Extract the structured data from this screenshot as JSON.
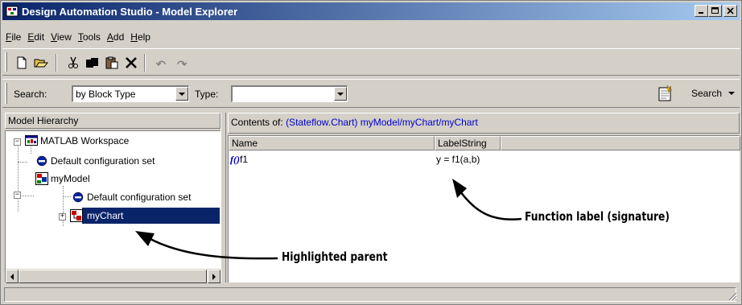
{
  "window": {
    "title": "Design Automation Studio - Model Explorer",
    "controls": {
      "minimize": "_",
      "maximize": "□",
      "close": "×"
    }
  },
  "menu": [
    {
      "label": "File",
      "accel": "F",
      "rest": "ile"
    },
    {
      "label": "Edit",
      "accel": "E",
      "rest": "dit"
    },
    {
      "label": "View",
      "accel": "V",
      "rest": "iew"
    },
    {
      "label": "Tools",
      "accel": "T",
      "rest": "ools"
    },
    {
      "label": "Add",
      "accel": "A",
      "rest": "dd"
    },
    {
      "label": "Help",
      "accel": "H",
      "rest": "elp"
    }
  ],
  "toolbar": {
    "buttons": [
      "new-icon",
      "open-icon",
      "cut-icon",
      "copy-icon",
      "paste-icon",
      "delete-icon",
      "undo-icon",
      "redo-icon"
    ]
  },
  "search": {
    "label": "Search:",
    "by_value": "by Block Type",
    "type_label": "Type:",
    "type_value": "",
    "button_label": "Search"
  },
  "hierarchy": {
    "header": "Model Hierarchy",
    "nodes": [
      {
        "label": "MATLAB Workspace",
        "icon": "workspace-icon"
      },
      {
        "label": "Default configuration set",
        "icon": "config-icon"
      },
      {
        "label": "myModel",
        "icon": "model-icon"
      },
      {
        "label": "Default configuration set",
        "icon": "config-icon"
      },
      {
        "label": "myChart",
        "icon": "chart-icon",
        "selected": true
      }
    ],
    "expanders": {
      "collapse": "−",
      "expand": "+"
    }
  },
  "contents": {
    "label": "Contents of:",
    "path": "(Stateflow.Chart) myModel/myChart/myChart",
    "columns": [
      "Name",
      "LabelString"
    ],
    "rows": [
      {
        "icon_text": "f()",
        "name": "f1",
        "label_string": "y = f1(a,b)"
      }
    ]
  },
  "annotations": {
    "function_label": "Function label (signature)",
    "highlighted_parent": "Highlighted parent"
  },
  "colors": {
    "selection": "#0a246a",
    "title_gradient_start": "#0a246a",
    "title_gradient_end": "#a6caf0",
    "path_link": "#0000cc",
    "chrome": "#d4d0c8"
  }
}
